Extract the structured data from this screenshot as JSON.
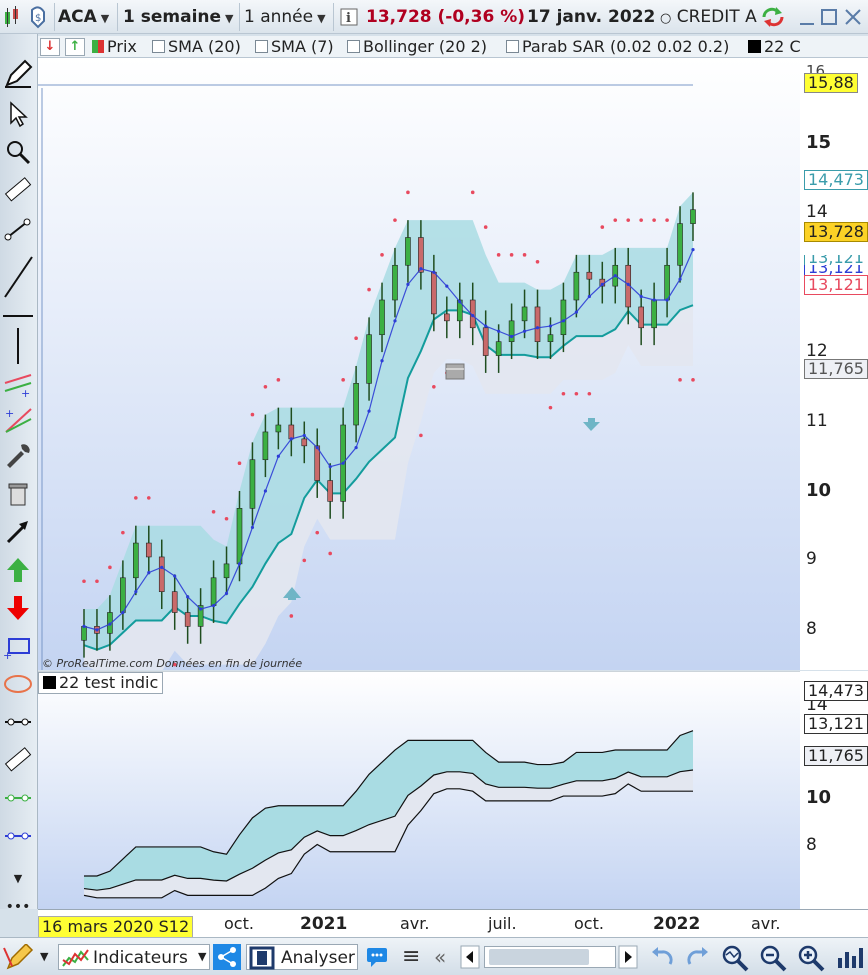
{
  "toolbar": {
    "ticker": "ACA",
    "interval": "1 semaine",
    "range": "1 année",
    "price_change": "13,728 (-0,36 %)",
    "date": "17 janv. 2022",
    "name": "CREDIT A"
  },
  "indicators": {
    "prix": "Prix",
    "sma20": "SMA (20)",
    "sma7": "SMA (7)",
    "bollinger": "Bollinger (20 2)",
    "sar": "Parab SAR (0.02 0.02 0.2)",
    "custom": "22 C"
  },
  "chart": {
    "credit": "© ProRealTime.com Données en fin de journée",
    "sub_title": "22 test indic",
    "axis_main": [
      "15",
      "14",
      "12",
      "11",
      "10",
      "9",
      "8"
    ],
    "axis_sub": [
      "14",
      "10",
      "8"
    ],
    "top_partial_tick": "16",
    "price_labels": {
      "top": "15,88",
      "upper": "14,473",
      "last": "13,728",
      "mid1": "13,121",
      "mid2": "13,121",
      "mid3": "13,121",
      "lower": "11,765"
    },
    "sub_labels": {
      "upper": "14,473",
      "mid": "13,121",
      "lower": "11,765"
    },
    "dates": [
      "oct.",
      "2021",
      "avr.",
      "juil.",
      "oct.",
      "2022",
      "avr."
    ],
    "cursor_date": "16 mars 2020 S12"
  },
  "chart_data": {
    "type": "line",
    "series": [
      {
        "name": "",
        "values": [
          7.7,
          7.6,
          7.9,
          8.4,
          8.9,
          8.7,
          8.2,
          7.9,
          7.7,
          8.0,
          8.4,
          8.6,
          9.4,
          10.1,
          10.5,
          10.6,
          10.4,
          10.3,
          9.8,
          9.5,
          10.6,
          11.2,
          11.9,
          12.4,
          12.9,
          13.3,
          12.8,
          12.2,
          12.1,
          12.4,
          12.0,
          11.6,
          11.8,
          12.1,
          12.3,
          11.8,
          11.9,
          12.4,
          12.8,
          12.7,
          12.6,
          12.9,
          12.3,
          12.0,
          12.4,
          12.9,
          13.5,
          13.7
        ]
      },
      {
        "name": "",
        "values": []
      },
      {
        "name": "",
        "values": []
      },
      {
        "name": "",
        "values": []
      }
    ],
    "ylim": [
      7,
      16
    ],
    "colors": {
      "band_upper": "#a9dce3",
      "band_lower": "#e3e7f0",
      "mid_line": "#139c9c",
      "sar": "#e84a5f",
      "sma": "#2d3dd6",
      "up_candle": "#3cb043",
      "down_candle": "#c96a6a"
    }
  },
  "bottom": {
    "indicateurs": "Indicateurs",
    "analyser": "Analyser"
  }
}
